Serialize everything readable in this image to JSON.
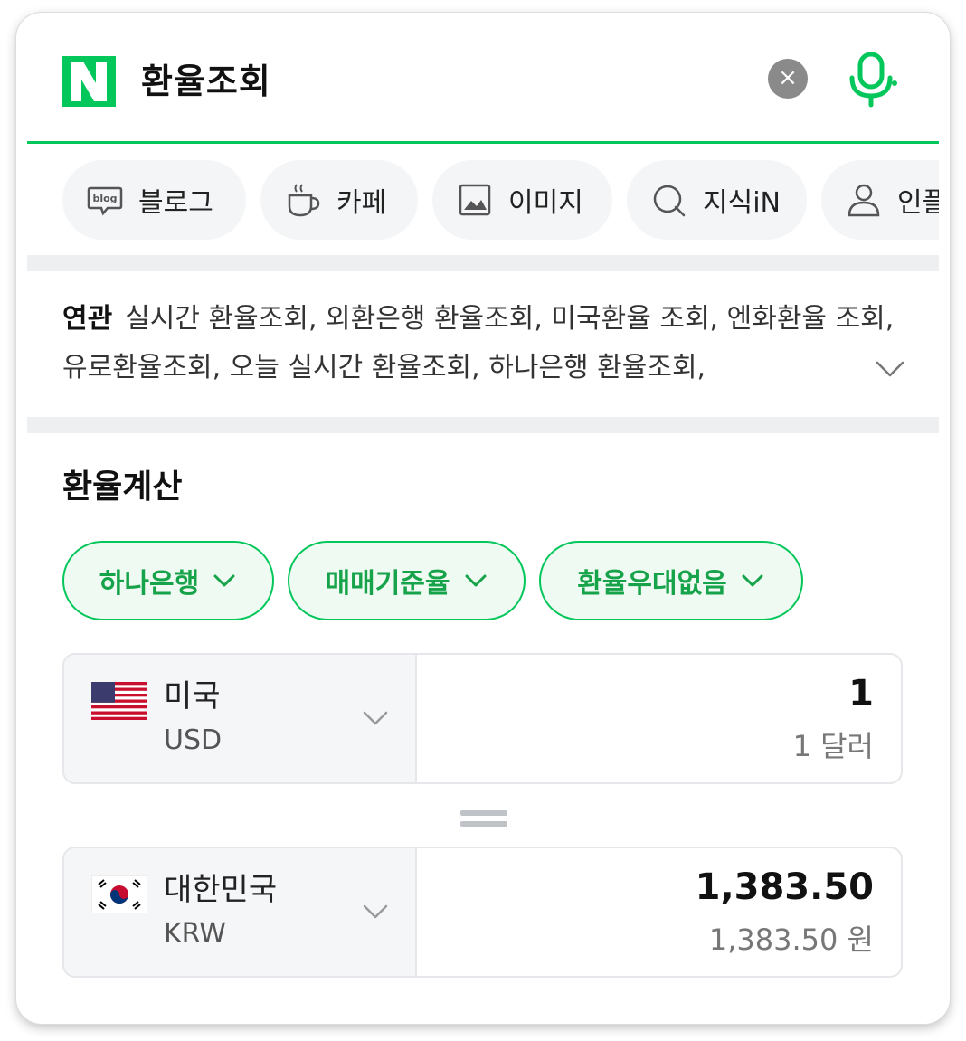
{
  "header": {
    "query": "환율조회",
    "brand_color": "#03c75a",
    "clear_icon": "×"
  },
  "tabs": [
    {
      "label": "블로그",
      "icon": "blog-icon"
    },
    {
      "label": "카페",
      "icon": "cafe-icon"
    },
    {
      "label": "이미지",
      "icon": "image-icon"
    },
    {
      "label": "지식iN",
      "icon": "knowledge-icon"
    },
    {
      "label": "인플",
      "icon": "person-icon"
    }
  ],
  "related": {
    "label": "연관",
    "text": "실시간 환율조회, 외환은행 환율조회, 미국환율 조회, 엔화환율 조회, 유로환율조회, 오늘 실시간 환율조회, 하나은행 환율조회, "
  },
  "calculator": {
    "title": "환율계산",
    "filters": [
      {
        "label": "하나은행"
      },
      {
        "label": "매매기준율"
      },
      {
        "label": "환율우대없음"
      }
    ],
    "from": {
      "country": "미국",
      "code": "USD",
      "amount": "1",
      "amount_text": "1 달러"
    },
    "to": {
      "country": "대한민국",
      "code": "KRW",
      "amount": "1,383.50",
      "amount_text": "1,383.50 원"
    }
  }
}
